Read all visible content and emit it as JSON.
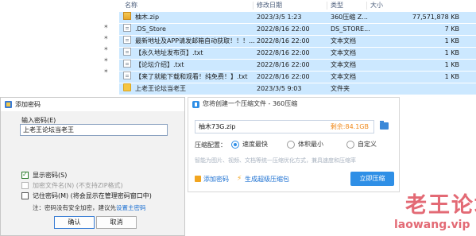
{
  "explorer": {
    "columns": {
      "name": "名称",
      "modified": "修改日期",
      "type": "类型",
      "size": "大小"
    },
    "files": [
      {
        "name": "柚木.zip",
        "modified": "2023/3/5 1:23",
        "type": "360压缩 Z...",
        "size": "77,571,878 KB",
        "icon": "zip-icon"
      },
      {
        "name": ".DS_Store",
        "modified": "2022/8/16 22:00",
        "type": "DS_STORE...",
        "size": "7 KB",
        "icon": "document-icon"
      },
      {
        "name": "最新地址及APP请发邮箱自动获取！！！...",
        "modified": "2022/8/16 22:00",
        "type": "文本文档",
        "size": "1 KB",
        "icon": "document-icon"
      },
      {
        "name": "【永久地址发布页】.txt",
        "modified": "2022/8/16 22:00",
        "type": "文本文档",
        "size": "1 KB",
        "icon": "document-icon"
      },
      {
        "name": "【论坛介绍】.txt",
        "modified": "2022/8/16 22:00",
        "type": "文本文档",
        "size": "1 KB",
        "icon": "document-icon"
      },
      {
        "name": "【来了就能下载和观看！纯免费！】.txt",
        "modified": "2022/8/16 22:00",
        "type": "文本文档",
        "size": "1 KB",
        "icon": "document-icon"
      },
      {
        "name": "上老王论坛当老王",
        "modified": "2023/3/5 9:03",
        "type": "文件夹",
        "size": "",
        "icon": "folder-icon"
      }
    ],
    "pins": [
      "pin-icon",
      "pin-icon",
      "pin-icon",
      "pin-icon",
      "pin-icon"
    ]
  },
  "password_dialog": {
    "title": "添加密码",
    "input_label": "输入密码(E)",
    "password_value": "上老王论坛当老王",
    "show_password": {
      "label": "显示密码(S)",
      "checked": true
    },
    "encrypt_filenames": {
      "label": "加密文件名(N) (不支持ZIP格式)",
      "checked": false,
      "disabled": true
    },
    "remember_password": {
      "label": "记住密码(M) (将会显示在管理密码窗口中)",
      "checked": false
    },
    "note_prefix": "注：密码没有安全加密，建议先",
    "note_link": "设置主密码",
    "ok_label": "确认",
    "cancel_label": "取消"
  },
  "compress_dialog": {
    "title": "您将创建一个压缩文件 - 360压缩",
    "filename": "柚木73G.zip",
    "remaining": "剩余:84.1GB",
    "config_label": "压缩配置：",
    "options": [
      {
        "label": "速度最快",
        "selected": true
      },
      {
        "label": "体积最小",
        "selected": false
      },
      {
        "label": "自定义",
        "selected": false
      }
    ],
    "description": "智能为图片、视频、文档等统一压缩优化方式，兼具速度和压缩率",
    "add_password_label": "添加密码",
    "sfx_label": "生成超级压缩包",
    "start_label": "立即压缩"
  },
  "watermark": {
    "text": "老王论坛",
    "url": "laowang.vip"
  },
  "colors": {
    "selection": "#cce8ff",
    "accent_blue": "#2f8fe6",
    "link_blue": "#1a6fd1",
    "orange": "#f08a1c",
    "watermark": "#e36a75"
  }
}
